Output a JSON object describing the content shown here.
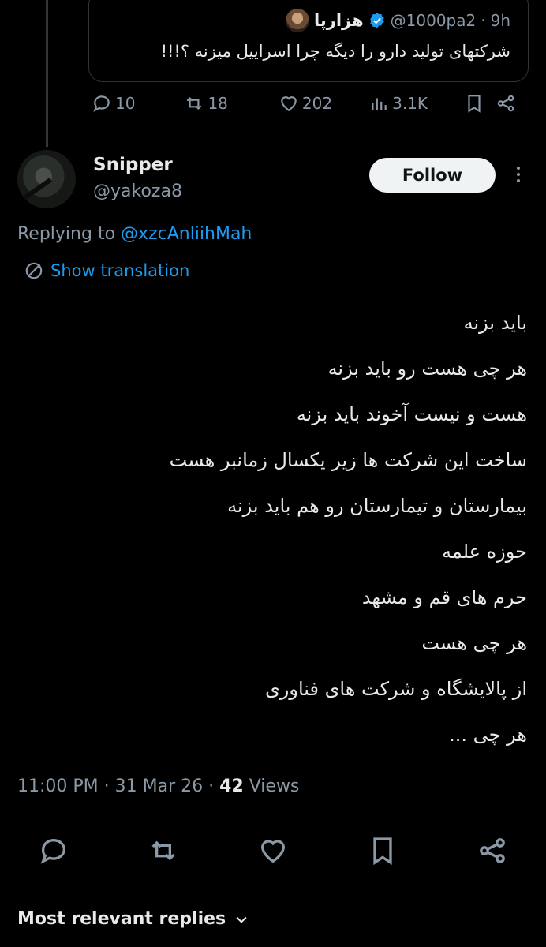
{
  "quoted": {
    "name": "هزارپا",
    "handle": "@1000pa2",
    "separator": "·",
    "time": "9h",
    "text": "شرکتهای تولید دارو را دیگه چرا اسراییل میزنه ؟!!!",
    "metrics": {
      "replies": "10",
      "reposts": "18",
      "likes": "202",
      "views": "3.1K"
    }
  },
  "author": {
    "name": "Snipper",
    "handle": "@yakoza8",
    "follow_label": "Follow"
  },
  "replying": {
    "prefix": "Replying to ",
    "target": "@xzcAnliihMah"
  },
  "translate_label": "Show translation",
  "tweet": {
    "lines": [
      "باید بزنه",
      "هر چی هست رو باید بزنه",
      "هست و نیست آخوند باید بزنه",
      "ساخت این شرکت ها زیر یکسال زمانبر هست",
      "بیمارستان و تیمارستان رو هم باید بزنه",
      "حوزه علمه",
      "حرم های قم و مشهد",
      "هر چی هست",
      "از پالایشگاه و شرکت های فناوری",
      "هر چی ..."
    ]
  },
  "meta": {
    "time": "11:00 PM",
    "sep1": " · ",
    "date": "31 Mar 26",
    "sep2": " · ",
    "views_count": "42",
    "views_label": " Views"
  },
  "sort_label": "Most relevant replies",
  "colors": {
    "background": "#000000",
    "text": "#e7e9ea",
    "muted": "#8b98a5",
    "link": "#1d9bf0",
    "border": "#2f3336"
  }
}
